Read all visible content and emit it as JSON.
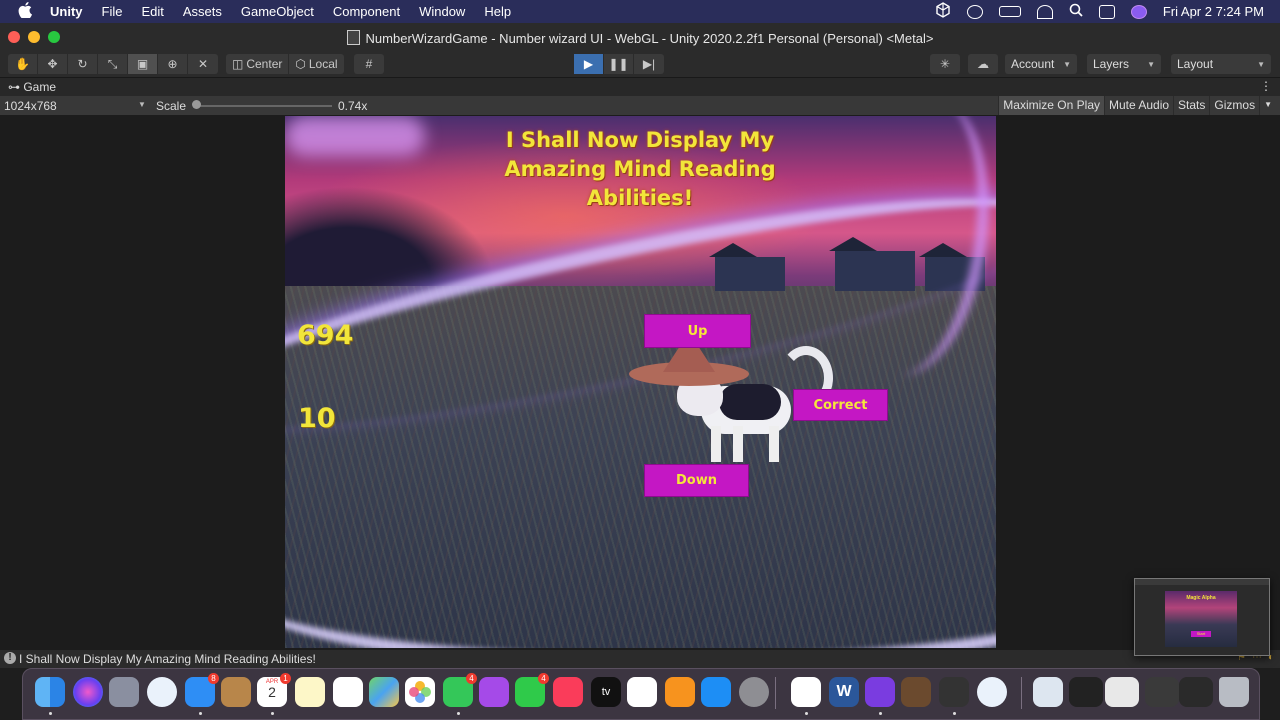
{
  "menubar": {
    "app": "Unity",
    "items": [
      "File",
      "Edit",
      "Assets",
      "GameObject",
      "Component",
      "Window",
      "Help"
    ],
    "datetime": "Fri Apr 2  7:24 PM"
  },
  "window": {
    "title": "NumberWizardGame - Number wizard UI - WebGL - Unity 2020.2.2f1 Personal (Personal) <Metal>"
  },
  "toolbar": {
    "pivot_label": "Center",
    "space_label": "Local",
    "account_label": "Account",
    "layers_label": "Layers",
    "layout_label": "Layout"
  },
  "game_view": {
    "tab_label": "Game",
    "resolution": "1024x768",
    "scale_label": "Scale",
    "scale_value": "0.74x",
    "maximize_label": "Maximize On Play",
    "mute_label": "Mute Audio",
    "stats_label": "Stats",
    "gizmos_label": "Gizmos"
  },
  "game": {
    "title": "I Shall Now Display My Amazing Mind Reading Abilities!",
    "guess": "694",
    "guesses_left": "10",
    "up_label": "Up",
    "correct_label": "Correct",
    "down_label": "Down"
  },
  "preview": {
    "title": "Magic Alpha",
    "button": "Start"
  },
  "status": {
    "message": "I Shall Now Display My Amazing Mind Reading Abilities!"
  },
  "dock": {
    "calendar_month": "APR",
    "calendar_day": "2",
    "mail_badge": "8",
    "calendar_badge": "1",
    "messages_badge": "4",
    "facetime_badge": "4",
    "word_label": "W",
    "tv_label": "tv"
  },
  "colors": {
    "game_text": "#f2e63a",
    "game_button": "#c417c4",
    "play_active": "#3b6fb0"
  }
}
